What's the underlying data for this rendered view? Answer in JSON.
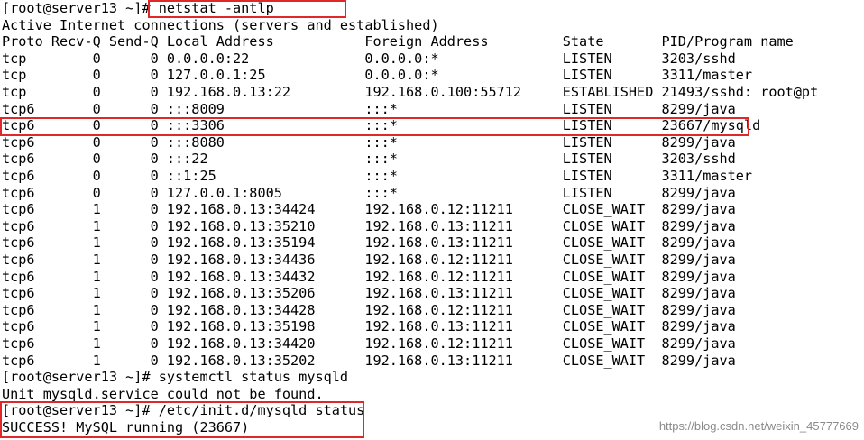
{
  "terminal": {
    "lines": [
      "[root@server13 ~]# netstat -antlp",
      "Active Internet connections (servers and established)",
      "Proto Recv-Q Send-Q Local Address           Foreign Address         State       PID/Program name",
      "tcp        0      0 0.0.0.0:22              0.0.0.0:*               LISTEN      3203/sshd",
      "tcp        0      0 127.0.0.1:25            0.0.0.0:*               LISTEN      3311/master",
      "tcp        0      0 192.168.0.13:22         192.168.0.100:55712     ESTABLISHED 21493/sshd: root@pt",
      "tcp6       0      0 :::8009                 :::*                    LISTEN      8299/java",
      "tcp6       0      0 :::3306                 :::*                    LISTEN      23667/mysqld",
      "tcp6       0      0 :::8080                 :::*                    LISTEN      8299/java",
      "tcp6       0      0 :::22                   :::*                    LISTEN      3203/sshd",
      "tcp6       0      0 ::1:25                  :::*                    LISTEN      3311/master",
      "tcp6       0      0 127.0.0.1:8005          :::*                    LISTEN      8299/java",
      "tcp6       1      0 192.168.0.13:34424      192.168.0.12:11211      CLOSE_WAIT  8299/java",
      "tcp6       1      0 192.168.0.13:35210      192.168.0.13:11211      CLOSE_WAIT  8299/java",
      "tcp6       1      0 192.168.0.13:35194      192.168.0.13:11211      CLOSE_WAIT  8299/java",
      "tcp6       1      0 192.168.0.13:34436      192.168.0.12:11211      CLOSE_WAIT  8299/java",
      "tcp6       1      0 192.168.0.13:34432      192.168.0.12:11211      CLOSE_WAIT  8299/java",
      "tcp6       1      0 192.168.0.13:35206      192.168.0.13:11211      CLOSE_WAIT  8299/java",
      "tcp6       1      0 192.168.0.13:34428      192.168.0.12:11211      CLOSE_WAIT  8299/java",
      "tcp6       1      0 192.168.0.13:35198      192.168.0.13:11211      CLOSE_WAIT  8299/java",
      "tcp6       1      0 192.168.0.13:34420      192.168.0.12:11211      CLOSE_WAIT  8299/java",
      "tcp6       1      0 192.168.0.13:35202      192.168.0.13:11211      CLOSE_WAIT  8299/java",
      "[root@server13 ~]# systemctl status mysqld",
      "Unit mysqld.service could not be found.",
      "[root@server13 ~]# /etc/init.d/mysqld status",
      "SUCCESS! MySQL running (23667)"
    ]
  },
  "watermark": "https://blog.csdn.net/weixin_45777669",
  "colors": {
    "highlight": "#e0282a",
    "text": "#000000",
    "background": "#ffffff"
  }
}
